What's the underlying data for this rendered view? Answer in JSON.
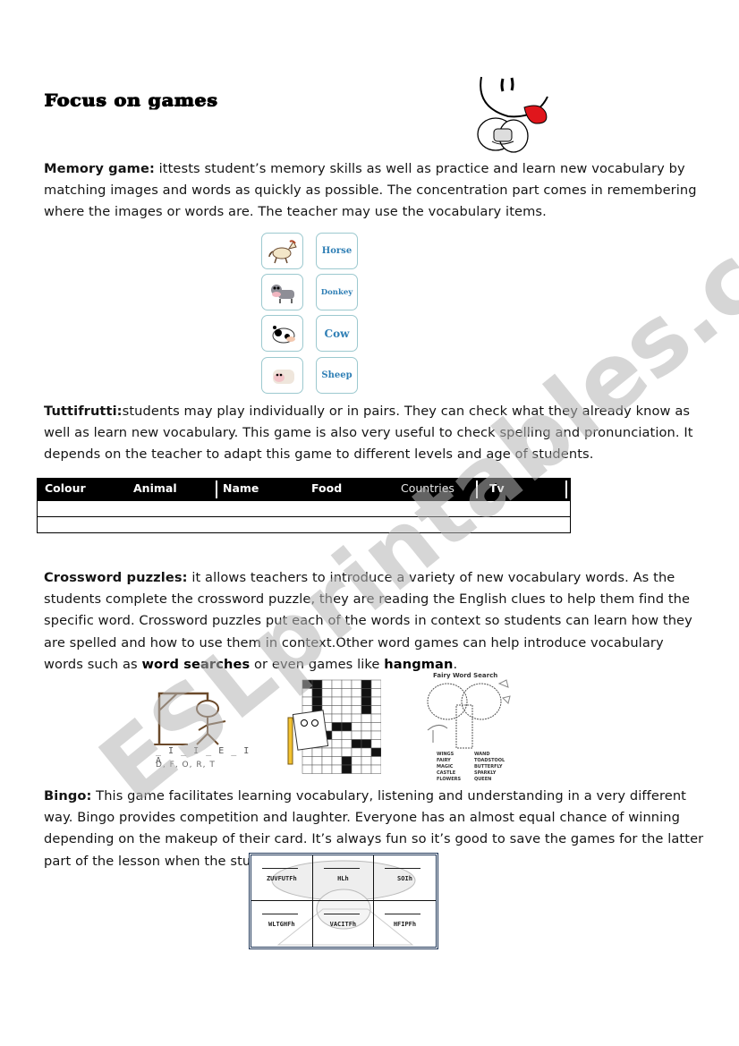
{
  "title": "Focus on games",
  "sections": {
    "memory": {
      "label": "Memory game:",
      "text": " ittests student’s memory skills as well as practice and learn new vocabulary by matching images and words as quickly as possible. The concentration part comes in remembering where the images or words are. The teacher may use the vocabulary items.",
      "cards": [
        {
          "picture": "horse-picture",
          "word": "Horse"
        },
        {
          "picture": "donkey-picture",
          "word": "Donkey"
        },
        {
          "picture": "cow-picture",
          "word": "Cow"
        },
        {
          "picture": "sheep-picture",
          "word": "Sheep"
        }
      ]
    },
    "tuttifrutti": {
      "label": "Tuttifrutti:",
      "text": "students may play individually or in pairs. They can check what they already know as well as learn new vocabulary. This game is also very useful to check spelling and pronunciation. It depends on the teacher to adapt this game to different levels and age of students.",
      "table": {
        "columns": [
          "Colour",
          "Animal",
          "Name",
          "Food",
          "Countries",
          "Tv"
        ],
        "rows": [
          [
            "",
            "",
            "",
            "",
            "",
            ""
          ],
          [
            "",
            "",
            "",
            "",
            "",
            ""
          ]
        ]
      }
    },
    "crossword": {
      "label": "Crossword puzzles:",
      "text_1": "  it allows teachers to introduce a variety of new vocabulary words. As the students complete the crossword puzzle, they are reading the English clues to help them find the specific word. Crossword puzzles put each of the words in context so students can learn how they are spelled and how to use them in context.Other word games can help introduce vocabulary words such as ",
      "bold_1": "word searches",
      "text_2": " or even games like ",
      "bold_2": "hangman",
      "text_3": "."
    },
    "images": {
      "hangman_blanks": "_ I _ I _ E _ I A",
      "hangman_letters": "D, F, O, R, T",
      "wordsearch_title": "Fairy Word Search",
      "wordsearch_words_left": [
        "WINGS",
        "FAIRY",
        "MAGIC",
        "CASTLE",
        "FLOWERS"
      ],
      "wordsearch_words_right": [
        "WAND",
        "TOADSTOOL",
        "BUTTERFLY",
        "SPARKLY",
        "QUEEN"
      ]
    },
    "bingo": {
      "label": "Bingo:",
      "text": "  This game facilitates learning vocabulary, listening and understanding in a very different way. Bingo provides competition and laughter. Everyone has an almost equal chance of winning depending on the makeup of their card. It’s always fun so it’s good to save the games for the latter part of the lesson when the students are tired.",
      "card_words": [
        "ZUVFUTFh",
        "HLh",
        "SOIh",
        "WLTGHFh",
        "VACITFh",
        "HFIPFh"
      ]
    }
  },
  "watermark": "ESLprintables.com",
  "colors": {
    "card_border": "#9cc9cf",
    "card_word": "#2f7fb5",
    "watermark": "#c8c8c8",
    "tongue": "#e0161c",
    "hangman": "#6b4a2b"
  }
}
